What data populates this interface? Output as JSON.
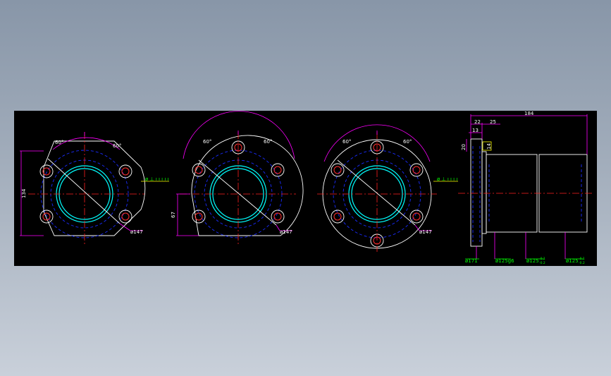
{
  "colors": {
    "background": "#000000",
    "outline": "#ffffff",
    "hidden": "#1a2cff",
    "centerline": "#ff2020",
    "dimension": "#ff00ff",
    "dimension_text": "#00ff00",
    "bore": "#00ffff",
    "holes": "#ff3030",
    "lines_yellow": "#ffff00"
  },
  "views": {
    "view1": {
      "angle_left": "60°",
      "angle_right": "60°",
      "height_dim": "134",
      "diameter": "ø147"
    },
    "view2": {
      "angle_left": "60°",
      "angle_right": "60°",
      "height_dim": "67",
      "diameter": "ø147"
    },
    "view3": {
      "angle_left": "60°",
      "angle_right": "60°",
      "diameter": "ø147"
    },
    "side": {
      "overall_length": "184",
      "dim_22": "22",
      "dim_25": "25",
      "dim_13": "13",
      "dim_20": "20",
      "dim_14": "14",
      "flange_dia": "ø171",
      "pilot_dia": "ø125g6",
      "body_dia_1": "ø125",
      "body_dia_1_tol_upper": "-0.1",
      "body_dia_1_tol_lower": "-0.2",
      "body_dia_2": "ø125",
      "body_dia_2_tol_upper": "-0.1",
      "body_dia_2_tol_lower": "-0.2"
    }
  }
}
